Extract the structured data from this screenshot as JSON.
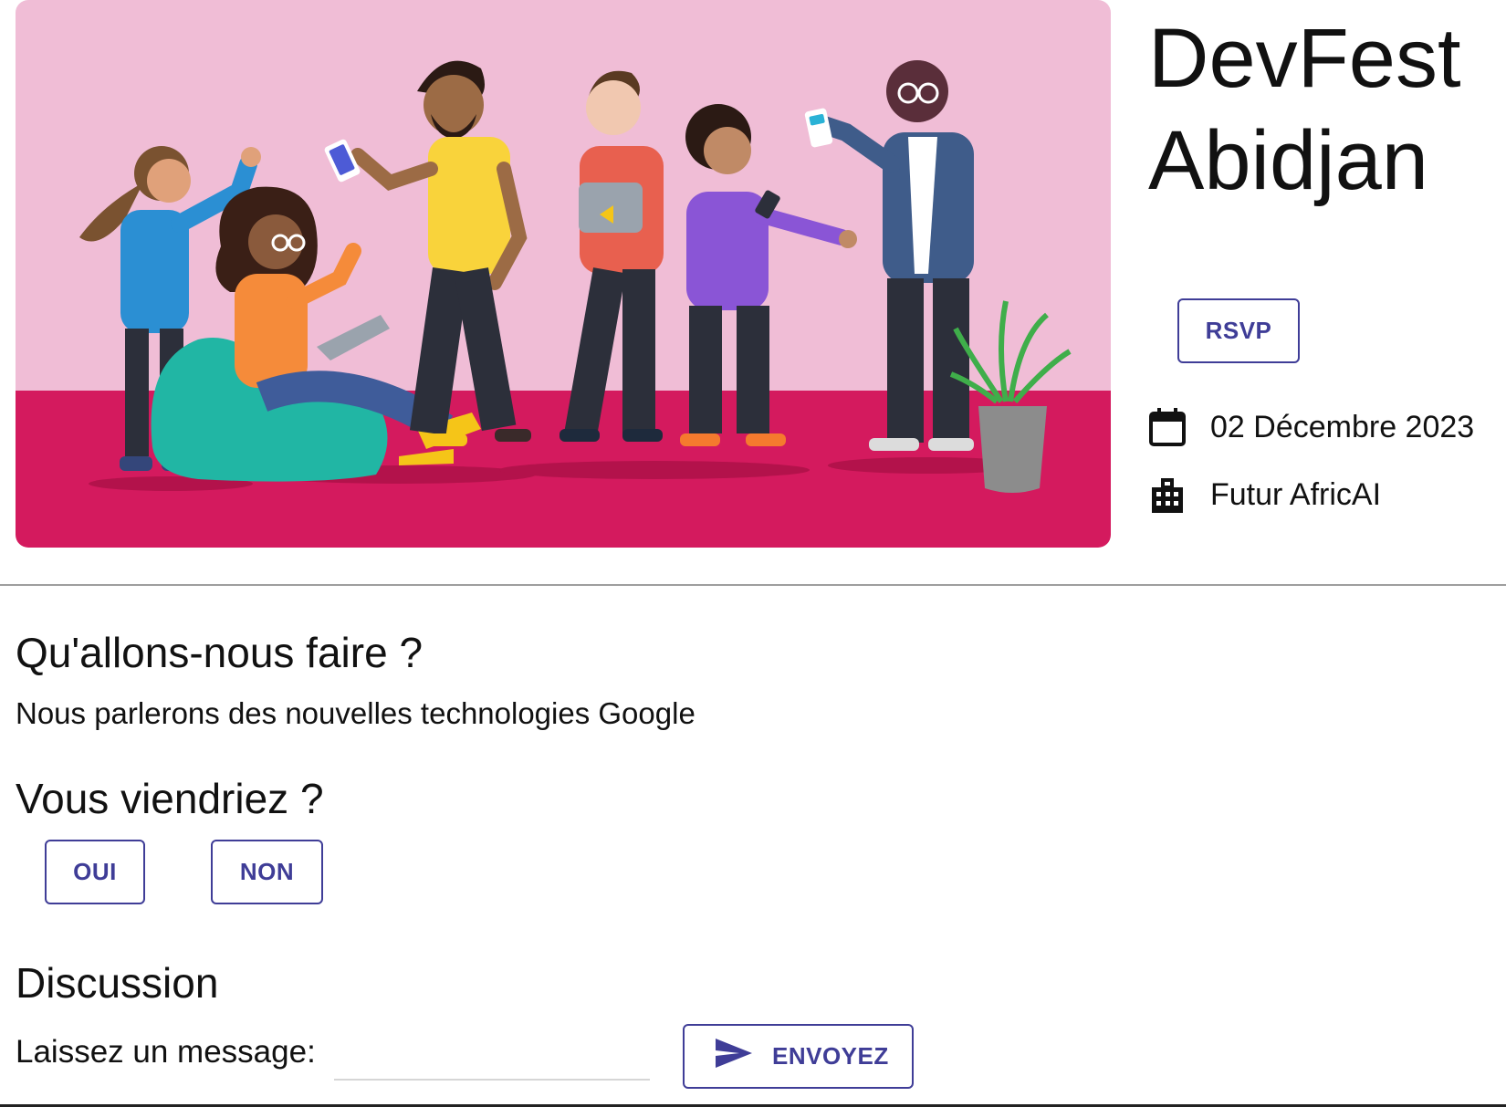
{
  "event": {
    "title_line1": "DevFest",
    "title_line2": "Abidjan",
    "rsvp_label": "RSVP",
    "date": "02 Décembre 2023",
    "venue": "Futur AfricAI",
    "date_icon": "calendar-icon",
    "venue_icon": "building-icon"
  },
  "hero": {
    "image_name": "people-illustration",
    "colors": {
      "wall": "#f0bdd6",
      "floor": "#d41a5e"
    }
  },
  "about": {
    "heading": "Qu'allons-nous faire ?",
    "text": "Nous parlerons des nouvelles technologies Google"
  },
  "attendance": {
    "heading": "Vous viendriez ?",
    "yes_label": "OUI",
    "no_label": "NON"
  },
  "discussion": {
    "heading": "Discussion",
    "message_label": "Laissez un message:",
    "message_value": "",
    "send_label": "ENVOYEZ",
    "send_icon": "send-icon"
  },
  "colors": {
    "accent": "#3f3d97",
    "divider": "#9e9e9e"
  }
}
